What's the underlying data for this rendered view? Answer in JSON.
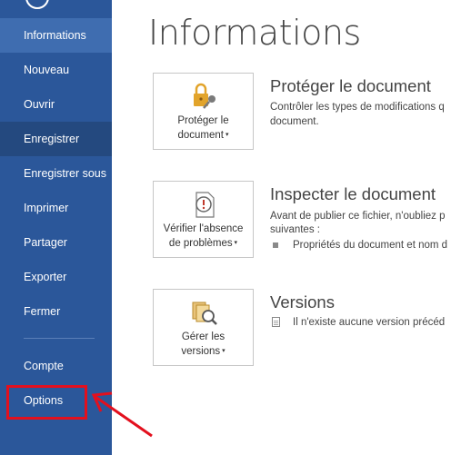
{
  "sidebar": {
    "items": [
      {
        "label": "Informations"
      },
      {
        "label": "Nouveau"
      },
      {
        "label": "Ouvrir"
      },
      {
        "label": "Enregistrer"
      },
      {
        "label": "Enregistrer sous"
      },
      {
        "label": "Imprimer"
      },
      {
        "label": "Partager"
      },
      {
        "label": "Exporter"
      },
      {
        "label": "Fermer"
      },
      {
        "label": "Compte"
      },
      {
        "label": "Options"
      }
    ],
    "selected": "Informations"
  },
  "main": {
    "title": "Informations",
    "sections": [
      {
        "button_line1": "Protéger le",
        "button_line2": "document",
        "title": "Protéger le document",
        "desc_line1": "Contrôler les types de modifications q",
        "desc_line2": "document."
      },
      {
        "button_line1": "Vérifier l'absence",
        "button_line2": "de problèmes",
        "title": "Inspecter le document",
        "desc_line1": "Avant de publier ce fichier, n'oubliez p",
        "desc_line2": "suivantes :",
        "bullet": "Propriétés du document et nom d"
      },
      {
        "button_line1": "Gérer les",
        "button_line2": "versions",
        "title": "Versions",
        "desc_line1": "Il n'existe aucune version précéd"
      }
    ]
  },
  "colors": {
    "sidebar_bg": "#2b579a",
    "highlight": "#e3101e"
  },
  "icons": [
    "back-arrow-icon",
    "lock-key-icon",
    "inspect-document-icon",
    "manage-versions-icon",
    "document-icon",
    "dropdown-caret-icon"
  ]
}
